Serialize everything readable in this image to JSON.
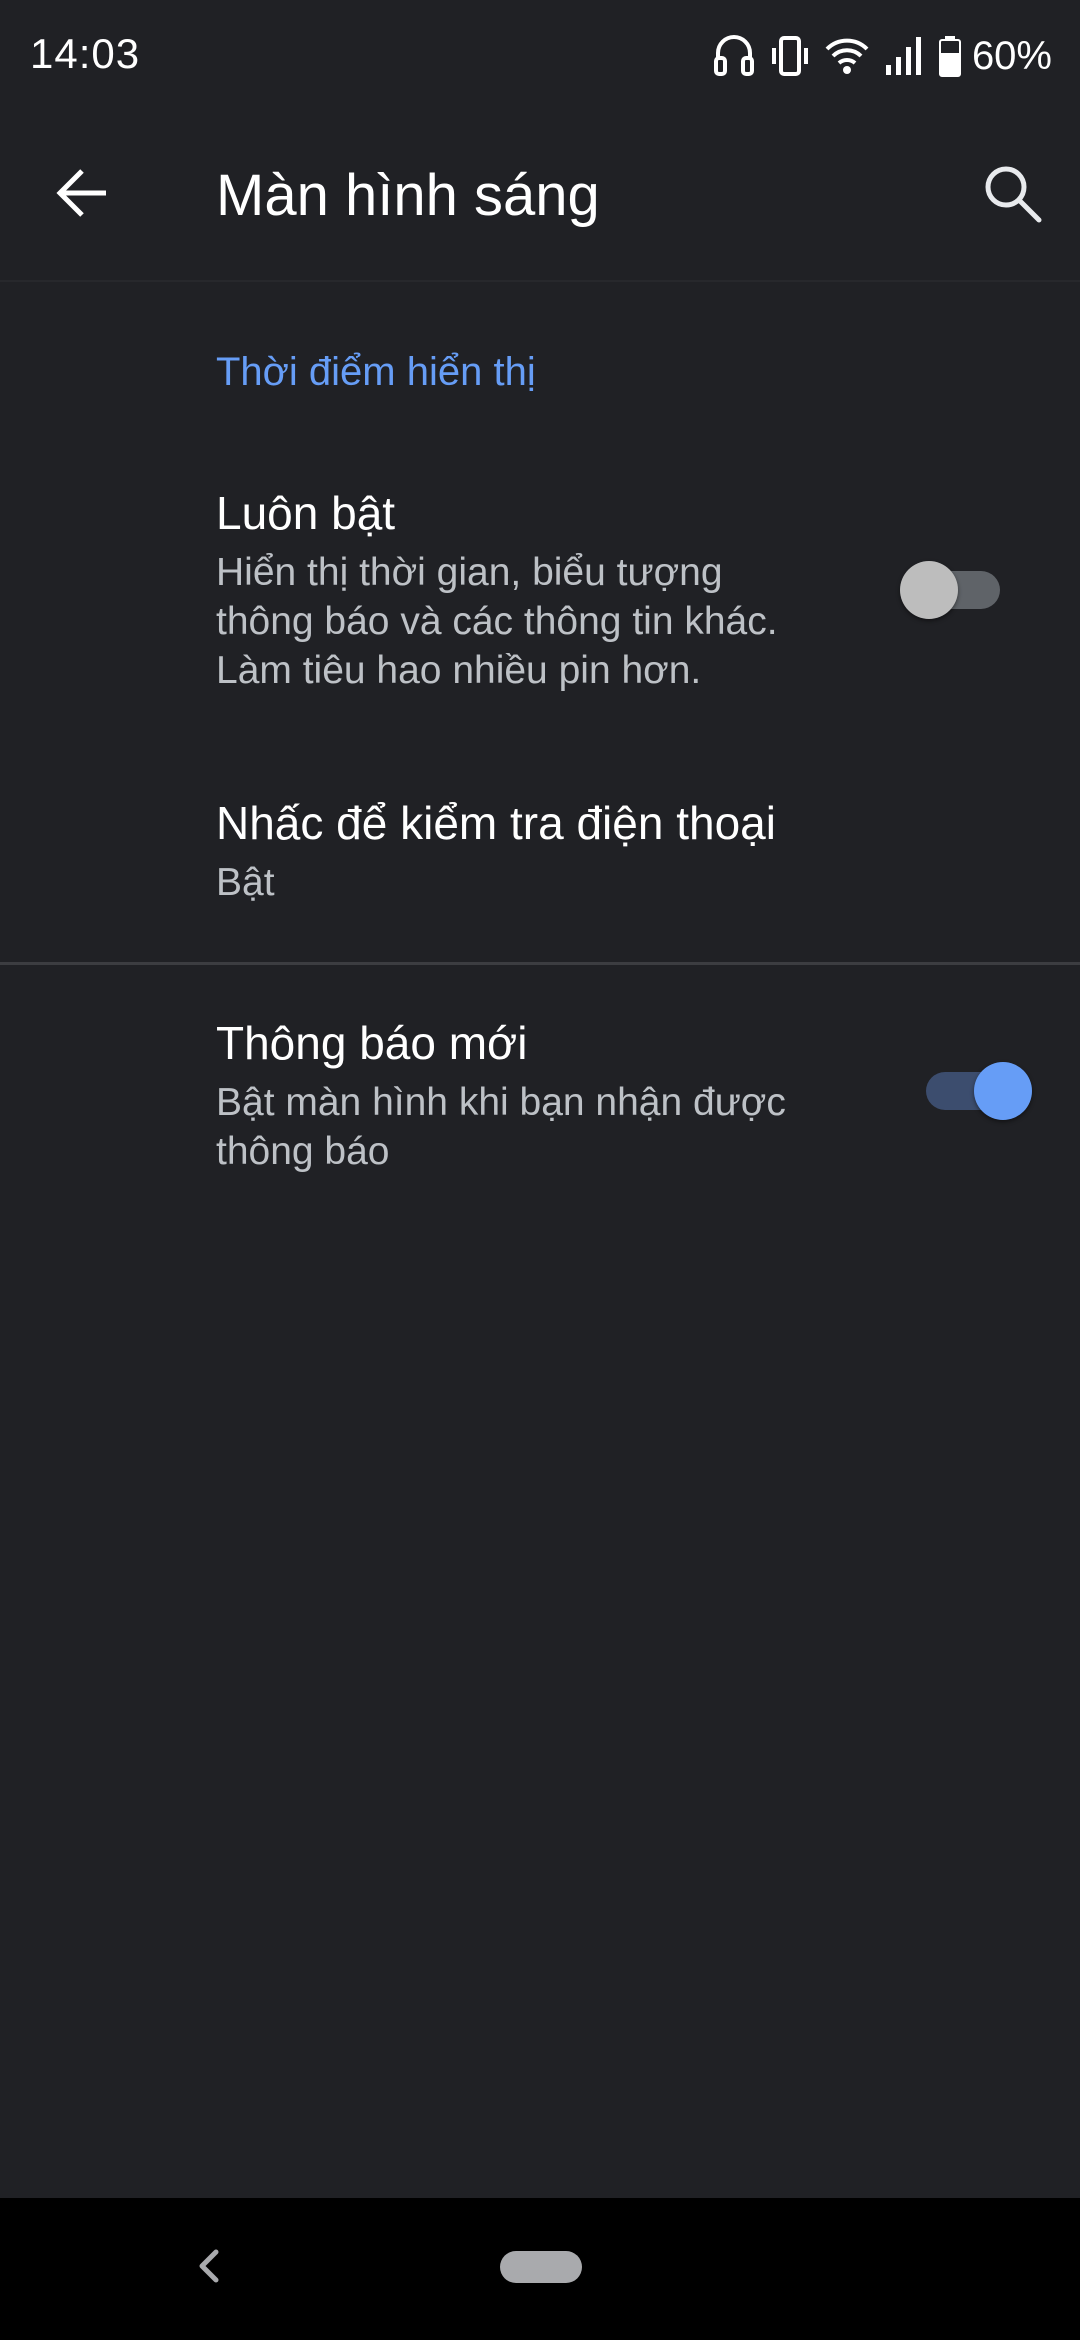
{
  "status_bar": {
    "time": "14:03",
    "battery_percent": "60%",
    "icons": [
      "headset-icon",
      "vibrate-icon",
      "wifi-icon",
      "signal-icon",
      "battery-icon"
    ]
  },
  "app_bar": {
    "title": "Màn hình sáng",
    "back_icon": "arrow-back-icon",
    "search_icon": "search-icon"
  },
  "section": {
    "header": "Thời điểm hiển thị"
  },
  "settings": [
    {
      "title": "Luôn bật",
      "summary_lines": [
        "Hiển thị thời gian, biểu tượng",
        "thông báo và các thông tin khác.",
        "Làm tiêu hao nhiều pin hơn."
      ],
      "toggle": false
    },
    {
      "title": "Nhấc để kiểm tra điện thoại",
      "summary_lines": [
        "Bật"
      ]
    },
    {
      "title": "Thông báo mới",
      "summary_lines": [
        "Bật màn hình khi bạn nhận được",
        "thông báo"
      ],
      "toggle": true
    }
  ],
  "colors": {
    "background": "#202125",
    "accent": "#669df6",
    "nav_bar": "#000000"
  }
}
